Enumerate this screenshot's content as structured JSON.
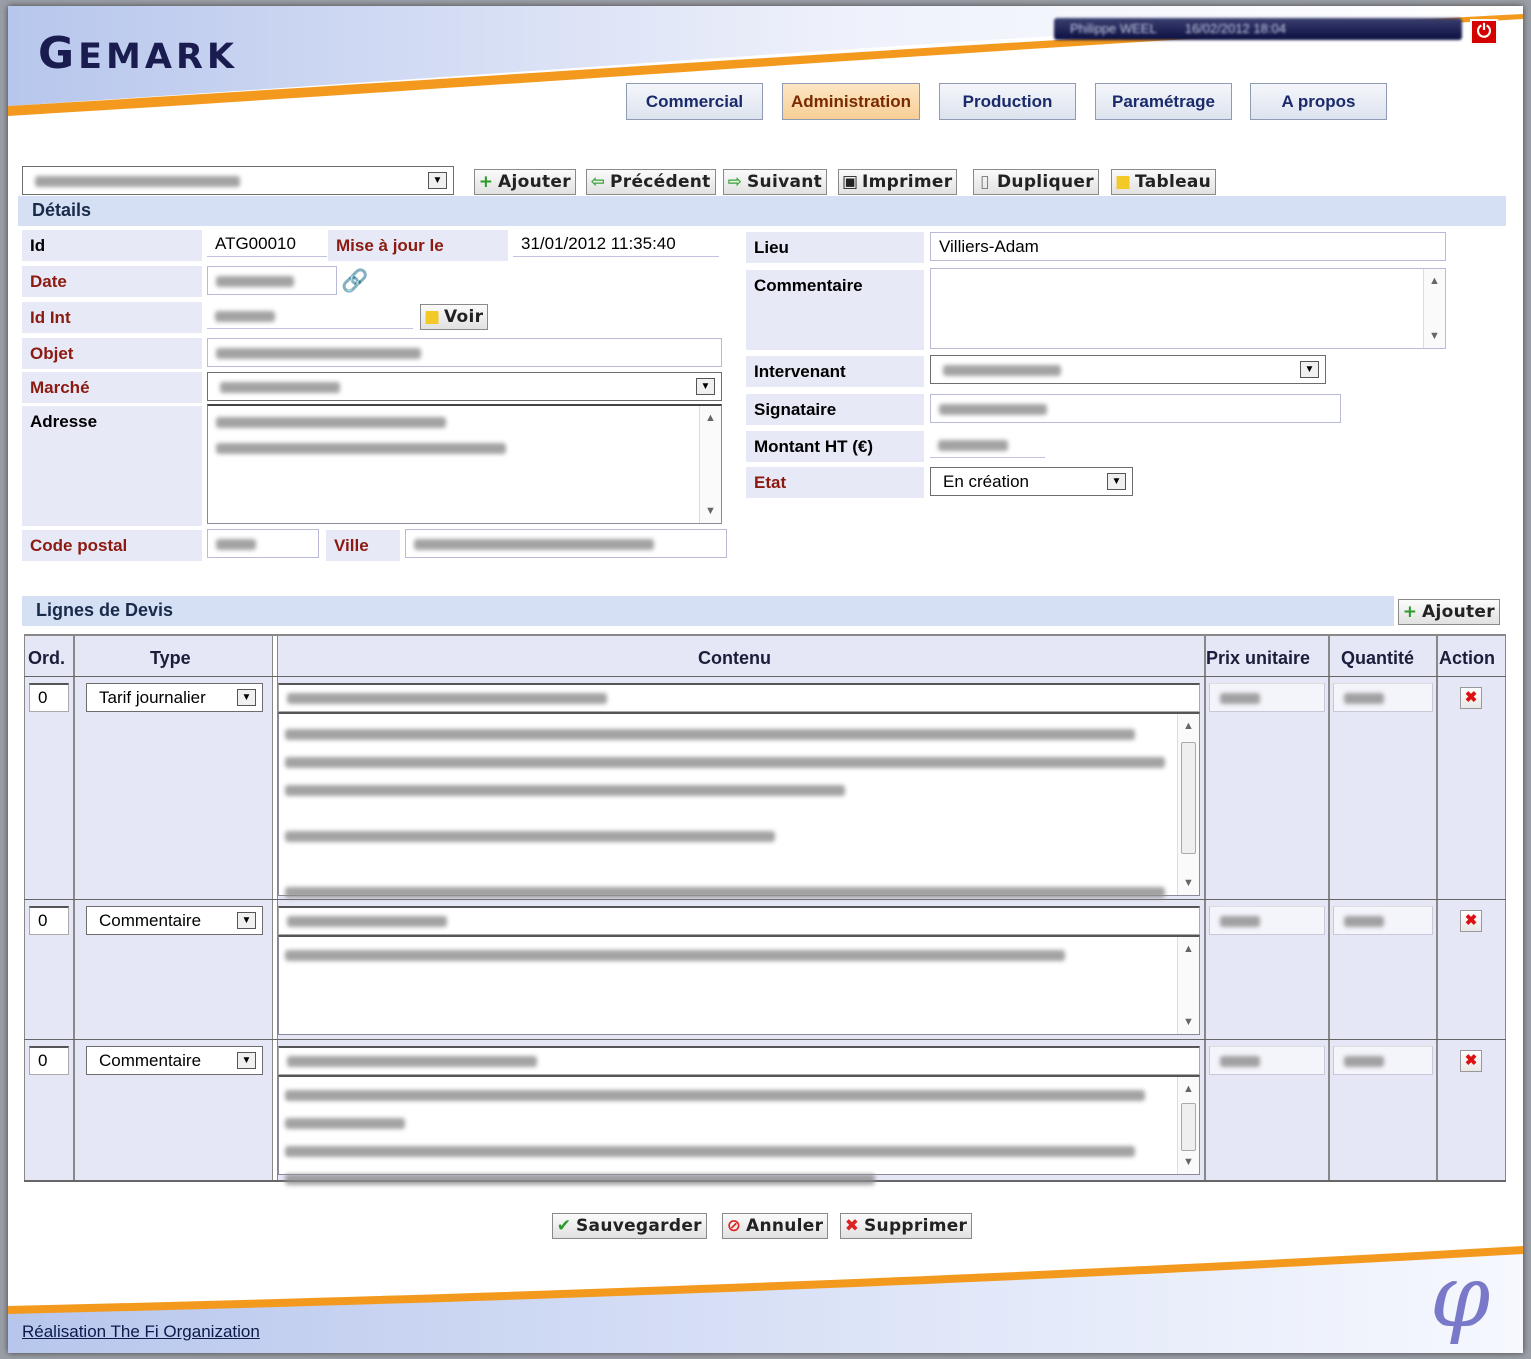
{
  "app": {
    "logo": "GEMARK",
    "user_info": "Philippe WEEL",
    "user_date": "16/02/2012 18:04",
    "power": "⏻"
  },
  "nav": {
    "tabs": [
      "Commercial",
      "Administration",
      "Production",
      "Paramétrage",
      "A propos"
    ],
    "active": "Administration"
  },
  "toolbar": {
    "record_select": "",
    "buttons": [
      "Ajouter",
      "Précédent",
      "Suivant",
      "Imprimer",
      "Dupliquer",
      "Tableau"
    ]
  },
  "details": {
    "section": "Détails",
    "id_label": "Id",
    "id_value": "ATG00010",
    "updated_label": "Mise à jour le",
    "updated_value": "31/01/2012 11:35:40",
    "date_label": "Date",
    "idint_label": "Id Int",
    "voir": "Voir",
    "objet_label": "Objet",
    "marche_label": "Marché",
    "adresse_label": "Adresse",
    "cp_label": "Code postal",
    "ville_label": "Ville",
    "lieu_label": "Lieu",
    "lieu_value": "Villiers-Adam",
    "commentaire_label": "Commentaire",
    "intervenant_label": "Intervenant",
    "signataire_label": "Signataire",
    "montant_label": "Montant HT (€)",
    "etat_label": "Etat",
    "etat_value": "En création"
  },
  "lines": {
    "section": "Lignes de Devis",
    "add": "Ajouter",
    "headers": {
      "ord": "Ord.",
      "type": "Type",
      "contenu": "Contenu",
      "prix": "Prix unitaire",
      "qte": "Quantité",
      "action": "Action"
    },
    "rows": [
      {
        "ord": "0",
        "type": "Tarif journalier"
      },
      {
        "ord": "0",
        "type": "Commentaire"
      },
      {
        "ord": "0",
        "type": "Commentaire"
      }
    ]
  },
  "actions": {
    "save": "Sauvegarder",
    "cancel": "Annuler",
    "delete": "Supprimer"
  },
  "footer": {
    "credit": "Réalisation The Fi Organization",
    "logo_glyph": "φ"
  },
  "colors": {
    "accent_orange": "#f39a1e",
    "nav_text": "#1a2a6b",
    "label_red": "#8b1a10",
    "label_bg": "#e8e9f7",
    "section_bg": "#d5e0f4"
  }
}
